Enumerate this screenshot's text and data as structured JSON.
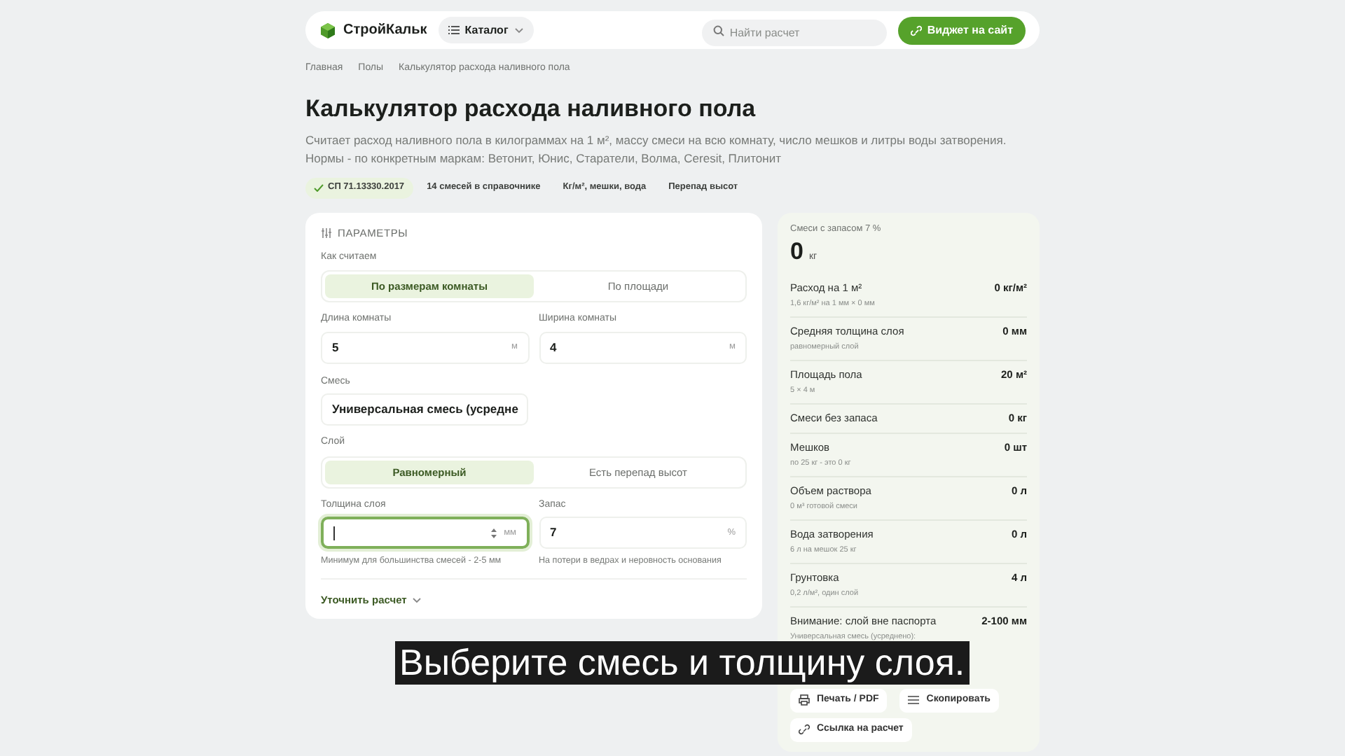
{
  "header": {
    "logo": "СтройКальк",
    "catalog": "Каталог",
    "search": {
      "placeholder": "Найти расчет"
    },
    "widget_button": "Виджет на сайт"
  },
  "breadcrumbs": [
    "Главная",
    "Полы",
    "Калькулятор расхода наливного пола"
  ],
  "title": "Калькулятор расхода наливного пола",
  "description": [
    "Считает расход наливного пола в килограммах на 1 м², массу смеси на всю комнату, число мешков и литры воды затворения.",
    "Нормы - по конкретным маркам: Ветонит, Юнис, Старатели, Волма, Ceresit, Плитонит"
  ],
  "tags": [
    {
      "label": "СП 71.13330.2017",
      "verified": true
    },
    {
      "label": "14 смесей в справочнике",
      "verified": false
    },
    {
      "label": "Кг/м², мешки, вода",
      "verified": false
    },
    {
      "label": "Перепад высот",
      "verified": false
    }
  ],
  "params": {
    "heading": "ПАРАМЕТРЫ",
    "mode": {
      "label": "Как считаем",
      "options": [
        {
          "label": "По размерам комнаты",
          "selected": true
        },
        {
          "label": "По площади",
          "selected": false
        }
      ]
    },
    "dims": [
      {
        "label": "Длина комнаты",
        "value": "5",
        "unit": "м",
        "focused": false,
        "spinner": false
      },
      {
        "label": "Ширина комнаты",
        "value": "4",
        "unit": "м",
        "focused": false,
        "spinner": false
      }
    ],
    "mix": {
      "label": "Смесь",
      "value": "Универсальная смесь (усредне"
    },
    "layer": {
      "label": "Слой",
      "options": [
        {
          "label": "Равномерный",
          "selected": true
        },
        {
          "label": "Есть перепад высот",
          "selected": false
        }
      ]
    },
    "fields": [
      {
        "label": "Толщина слоя",
        "unit": "мм",
        "focused": true,
        "spinner": true,
        "hint": "Минимум для большинства смесей - 2-5 мм"
      },
      {
        "label": "Запас",
        "value": "7",
        "unit": "%",
        "focused": false,
        "spinner": false,
        "hint": "На потери в ведрах и неровность основания"
      }
    ],
    "refine": "Уточнить расчет"
  },
  "results": {
    "total_label": "Смеси с запасом 7 %",
    "total_value": "0",
    "total_unit": "кг",
    "rows": [
      {
        "label": "Расход на 1 м²",
        "sub": "1,6 кг/м² на 1 мм × 0 мм",
        "value": "0 кг/м²"
      },
      {
        "label": "Средняя толщина слоя",
        "sub": "равномерный слой",
        "value": "0 мм"
      },
      {
        "label": "Площадь пола",
        "sub": "5 × 4 м",
        "value": "20 м²"
      },
      {
        "label": "Смеси без запаса",
        "value": "0 кг"
      },
      {
        "label": "Мешков",
        "sub": "по 25 кг - это 0 кг",
        "value": "0 шт"
      },
      {
        "label": "Объем раствора",
        "sub": "0 м³ готовой смеси",
        "value": "0 л"
      },
      {
        "label": "Вода затворения",
        "sub": "6 л на мешок 25 кг",
        "value": "0 л"
      },
      {
        "label": "Грунтовка",
        "sub": "0,2 л/м², один слой",
        "value": "4 л"
      },
      {
        "label": "Внимание: слой вне паспорта",
        "sub": "Универсальная смесь (усреднено):",
        "value": "2-100 мм"
      }
    ],
    "actions": [
      {
        "label": "Печать / PDF",
        "kind": "print"
      },
      {
        "label": "Скопировать",
        "kind": "copy"
      },
      {
        "label": "Ссылка на расчет",
        "kind": "link"
      }
    ]
  },
  "subtitle": "Выберите смесь и толщину слоя."
}
